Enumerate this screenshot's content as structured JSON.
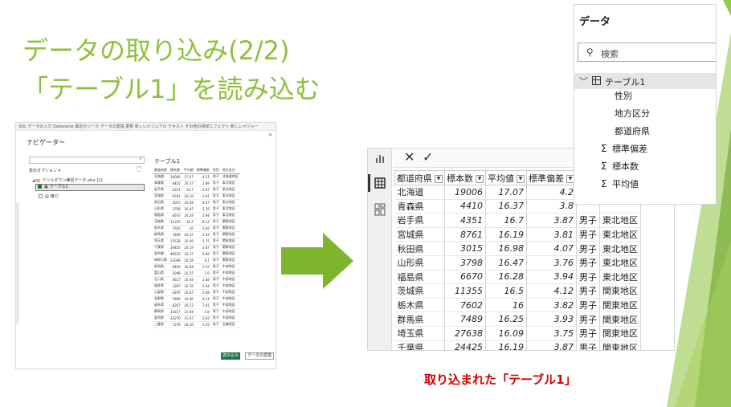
{
  "slide": {
    "title_line1": "データの取り込み(2/2)",
    "title_line2": "「テーブル1」を読み込む",
    "caption": "取り込まれた「テーブル1」",
    "colors": {
      "title": "#8DC13C",
      "caption": "#D40000",
      "accent_green": "#7DB52C",
      "excel_green": "#217346"
    }
  },
  "navigator": {
    "ribbon_text": "SQL  データの入力  Dataverse  最近のソース   データの変換   更新   新しいビジュアル  テキスト その他の視覚エフェクト  新しいメジャー",
    "title": "ナビゲーター",
    "close_icon": "close-icon",
    "display_options": "表示オプション ▾",
    "folder_item": "ドリルダウン練習データ.xlsx [2]",
    "table_item": "テーブル1",
    "other_item": "権力",
    "preview_title": "テーブル1",
    "columns": [
      "都道府県",
      "標本数",
      "平均値",
      "標準偏差",
      "性別",
      "地方区分"
    ],
    "rows": [
      [
        "北海道",
        "19006",
        "17.07",
        "4.21",
        "男子",
        "北海道地区"
      ],
      [
        "青森県",
        "4410",
        "16.37",
        "3.89",
        "男子",
        "東北地区"
      ],
      [
        "岩手県",
        "4351",
        "16.7",
        "3.87",
        "男子",
        "東北地区"
      ],
      [
        "宮城県",
        "8761",
        "16.19",
        "3.81",
        "男子",
        "東北地区"
      ],
      [
        "秋田県",
        "3015",
        "16.98",
        "4.07",
        "男子",
        "東北地区"
      ],
      [
        "山形県",
        "3798",
        "16.47",
        "3.76",
        "男子",
        "東北地区"
      ],
      [
        "福島県",
        "6670",
        "16.28",
        "3.94",
        "男子",
        "東北地区"
      ],
      [
        "茨城県",
        "11355",
        "16.5",
        "4.12",
        "男子",
        "関東地区"
      ],
      [
        "栃木県",
        "7602",
        "16",
        "3.82",
        "男子",
        "関東地区"
      ],
      [
        "群馬県",
        "7489",
        "16.25",
        "3.93",
        "男子",
        "関東地区"
      ],
      [
        "埼玉県",
        "27638",
        "16.09",
        "3.75",
        "男子",
        "関東地区"
      ],
      [
        "千葉県",
        "24425",
        "16.19",
        "3.87",
        "男子",
        "関東地区"
      ],
      [
        "東京都",
        "46630",
        "16.37",
        "3.89",
        "男子",
        "関東地区"
      ],
      [
        "神奈川県",
        "33048",
        "16.58",
        "4.1",
        "男子",
        "関東地区"
      ],
      [
        "新潟県",
        "8456",
        "16.84",
        "3.97",
        "男子",
        "中部地区"
      ],
      [
        "富山県",
        "3948",
        "16.55",
        "3.9",
        "男子",
        "中部地区"
      ],
      [
        "石川県",
        "4617",
        "16.68",
        "3.88",
        "男子",
        "中部地区"
      ],
      [
        "福井県",
        "3287",
        "16.76",
        "3.94",
        "男子",
        "中部地区"
      ],
      [
        "山梨県",
        "2876",
        "16.05",
        "3.88",
        "男子",
        "中部地区"
      ],
      [
        "長野県",
        "7809",
        "16.86",
        "4.11",
        "男子",
        "中部地区"
      ],
      [
        "岐阜県",
        "8267",
        "16.53",
        "3.91",
        "男子",
        "中部地区"
      ],
      [
        "静岡県",
        "14317",
        "15.84",
        "3.8",
        "男子",
        "中部地区"
      ],
      [
        "愛知県",
        "32270",
        "15.67",
        "3.83",
        "男子",
        "中部地区"
      ],
      [
        "三重県",
        "7379",
        "16.36",
        "3.93",
        "男子",
        "近畿地区"
      ]
    ],
    "load_button": "読み込み",
    "transform_button": "データの変換"
  },
  "dataview": {
    "cancel_symbol": "✕",
    "commit_symbol": "✓",
    "columns": [
      "都道府県",
      "標本数",
      "平均値",
      "標準偏差"
    ],
    "rows": [
      [
        "北海道",
        "19006",
        "17.07",
        "4.2",
        "",
        ""
      ],
      [
        "青森県",
        "4410",
        "16.37",
        "3.8",
        "",
        ""
      ],
      [
        "岩手県",
        "4351",
        "16.7",
        "3.87",
        "男子",
        "東北地区"
      ],
      [
        "宮城県",
        "8761",
        "16.19",
        "3.81",
        "男子",
        "東北地区"
      ],
      [
        "秋田県",
        "3015",
        "16.98",
        "4.07",
        "男子",
        "東北地区"
      ],
      [
        "山形県",
        "3798",
        "16.47",
        "3.76",
        "男子",
        "東北地区"
      ],
      [
        "福島県",
        "6670",
        "16.28",
        "3.94",
        "男子",
        "東北地区"
      ],
      [
        "茨城県",
        "11355",
        "16.5",
        "4.12",
        "男子",
        "関東地区"
      ],
      [
        "栃木県",
        "7602",
        "16",
        "3.82",
        "男子",
        "関東地区"
      ],
      [
        "群馬県",
        "7489",
        "16.25",
        "3.93",
        "男子",
        "関東地区"
      ],
      [
        "埼玉県",
        "27638",
        "16.09",
        "3.75",
        "男子",
        "関東地区"
      ],
      [
        "千葉県",
        "24425",
        "16.19",
        "3.87",
        "男子",
        "関東地区"
      ]
    ]
  },
  "fields": {
    "title": "データ",
    "search_placeholder": "検索",
    "table_name": "テーブル1",
    "items": [
      {
        "label": "性別",
        "sigma": false
      },
      {
        "label": "地方区分",
        "sigma": false
      },
      {
        "label": "都道府県",
        "sigma": false
      },
      {
        "label": "標準偏差",
        "sigma": true
      },
      {
        "label": "標本数",
        "sigma": true
      },
      {
        "label": "平均値",
        "sigma": true
      }
    ]
  }
}
